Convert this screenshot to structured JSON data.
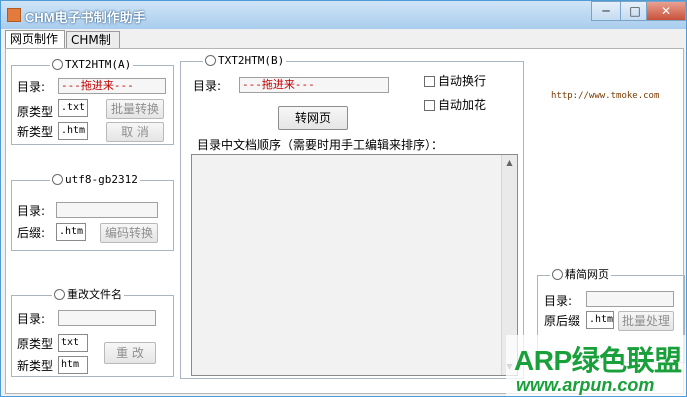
{
  "window": {
    "title": "CHM电子书制作助手",
    "minimize_glyph": "─",
    "maximize_glyph": "□",
    "close_glyph": "✕",
    "app_icon": "pencil-icon"
  },
  "tabs": [
    {
      "label": "网页制作",
      "active": true
    },
    {
      "label": "CHM制作",
      "active": false
    }
  ],
  "txt2htm_a": {
    "legend": "TXT2HTM(A)",
    "dir_label": "目录:",
    "dir_value": "---拖进来---",
    "orig_type_label": "原类型",
    "orig_type_value": ".txt",
    "new_type_label": "新类型",
    "new_type_value": ".htm",
    "batch_button": "批量转换",
    "cancel_button": "取 消"
  },
  "utf8_gb2312": {
    "legend": "utf8-gb2312",
    "dir_label": "目录:",
    "dir_value": "",
    "suffix_label": "后缀:",
    "suffix_value": ".htm",
    "encode_button": "编码转换"
  },
  "rename": {
    "legend": "重改文件名",
    "dir_label": "目录:",
    "dir_value": "",
    "orig_type_label": "原类型",
    "orig_type_value": "txt",
    "new_type_label": "新类型",
    "new_type_value": "htm",
    "rename_button": "重 改"
  },
  "txt2htm_b": {
    "legend": "TXT2HTM(B)",
    "dir_label": "目录:",
    "dir_value": "---拖进来---",
    "auto_wrap_label": "自动换行",
    "auto_decorate_label": "自动加花",
    "convert_button": "转网页",
    "list_caption": "目录中文档顺序（需要时用手工编辑来排序）："
  },
  "simplify": {
    "legend": "精简网页",
    "dir_label": "目录:",
    "dir_value": "",
    "suffix_label": "原后缀",
    "suffix_value": ".htm",
    "batch_button": "批量处理"
  },
  "site_url": "http://www.tmoke.com",
  "watermark": {
    "main": "ARP绿色联盟",
    "sub": "www.arpun.com"
  },
  "colors": {
    "title_gradient_top": "#cfe4f7",
    "title_gradient_bottom": "#a9cdee",
    "drag_hint": "#c00000",
    "watermark": "#1aa03a",
    "url": "#7a3a00"
  }
}
